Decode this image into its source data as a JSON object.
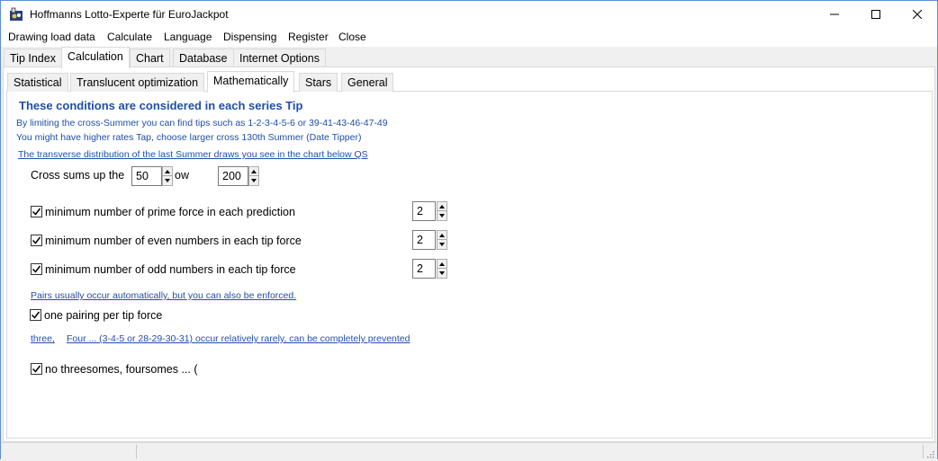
{
  "window": {
    "title": "Hoffmanns Lotto-Experte  für EuroJackpot"
  },
  "menu": [
    "Drawing load data",
    "Calculate",
    "Language",
    "Dispensing",
    "Register",
    "Close"
  ],
  "main_tabs": [
    "Tip Index",
    "Calculation",
    "Chart",
    "Database",
    "Internet Options"
  ],
  "main_tab_active": "Calculation",
  "sub_tabs": [
    "Statistical",
    "Translucent optimization",
    "Mathematically",
    "Stars",
    "General"
  ],
  "sub_tab_active": "Mathematically",
  "content": {
    "heading": "These conditions are considered in each series Tip",
    "info1": "By limiting the cross-Summer you can find tips such as 1-2-3-4-5-6 or 39-41-43-46-47-49",
    "info2": "You might have higher rates Tap, choose larger cross 130th Summer (Date Tipper)",
    "link_distribution": "The transverse distribution of the last Summer draws you see in the chart below QS",
    "cross_sums_label": "Cross sums up the",
    "cross_sums_from": "50",
    "cross_sums_mid": "ow",
    "cross_sums_to": "200",
    "prime_label": "minimum number of prime force in each prediction",
    "prime_value": "2",
    "prime_checked": true,
    "even_label": "minimum number of even numbers in each tip force",
    "even_value": "2",
    "even_checked": true,
    "odd_label": "minimum number of odd numbers in each tip force",
    "odd_value": "2",
    "odd_checked": true,
    "pairs_link": "Pairs usually occur automatically, but you can also be enforced.",
    "pairing_label": "one pairing per tip force",
    "pairing_checked": true,
    "three_link": "three,",
    "four_link": "Four ... (3-4-5 or 28-29-30-31) occur relatively rarely, can be completely prevented",
    "threesomes_label": "no threesomes, foursomes ... (",
    "threesomes_checked": true
  }
}
